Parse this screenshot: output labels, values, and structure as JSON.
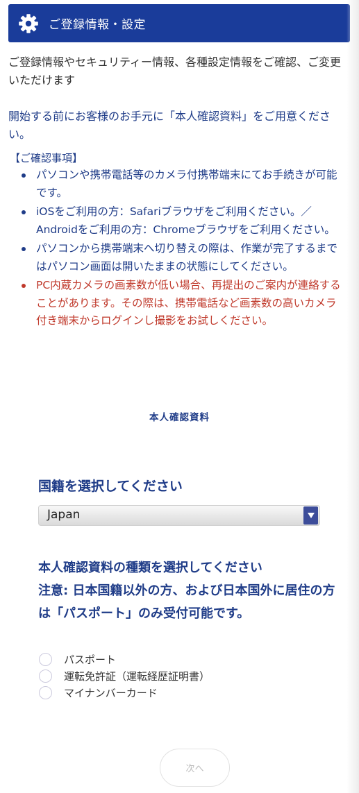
{
  "header": {
    "title": "ご登録情報・設定",
    "icon": "gear-icon"
  },
  "intro": "ご登録情報やセキュリティー情報、各種設定情報をご確認、ご変更いただけます",
  "prepare": "開始する前にお客様のお手元に「本人確認資料」をご用意ください。",
  "notes": {
    "title": "【ご確認事項】",
    "items": [
      "パソコンや携帯電話等のカメラ付携帯端末にてお手続きが可能です。",
      "iOSをご利用の方：Safariブラウザをご利用ください。／Androidをご利用の方：Chromeブラウザをご利用ください。",
      "パソコンから携帯端末へ切り替えの際は、作業が完了するまではパソコン画面は開いたままの状態にしてください。",
      "PC内蔵カメラの画素数が低い場合、再提出のご案内が連絡することがあります。その際は、携帯電話など画素数の高いカメラ付き端末からログインし撮影をお試しください。"
    ]
  },
  "section_label": "本人確認資料",
  "nationality": {
    "label": "国籍を選択してください",
    "selected": "Japan"
  },
  "document_type": {
    "label": "本人確認資料の種類を選択してください",
    "notice": "注意: 日本国籍以外の方、および日本国外に居住の方は「パスポート」のみ受付可能です。",
    "options": [
      "パスポート",
      "運転免許証（運転経歴証明書）",
      "マイナンバーカード"
    ]
  },
  "next_button": "次へ",
  "colors": {
    "header_bg": "#1a3c9a",
    "text_blue": "#1f3c88",
    "warning_red": "#c0392b",
    "select_arrow": "#3d4d9a"
  }
}
